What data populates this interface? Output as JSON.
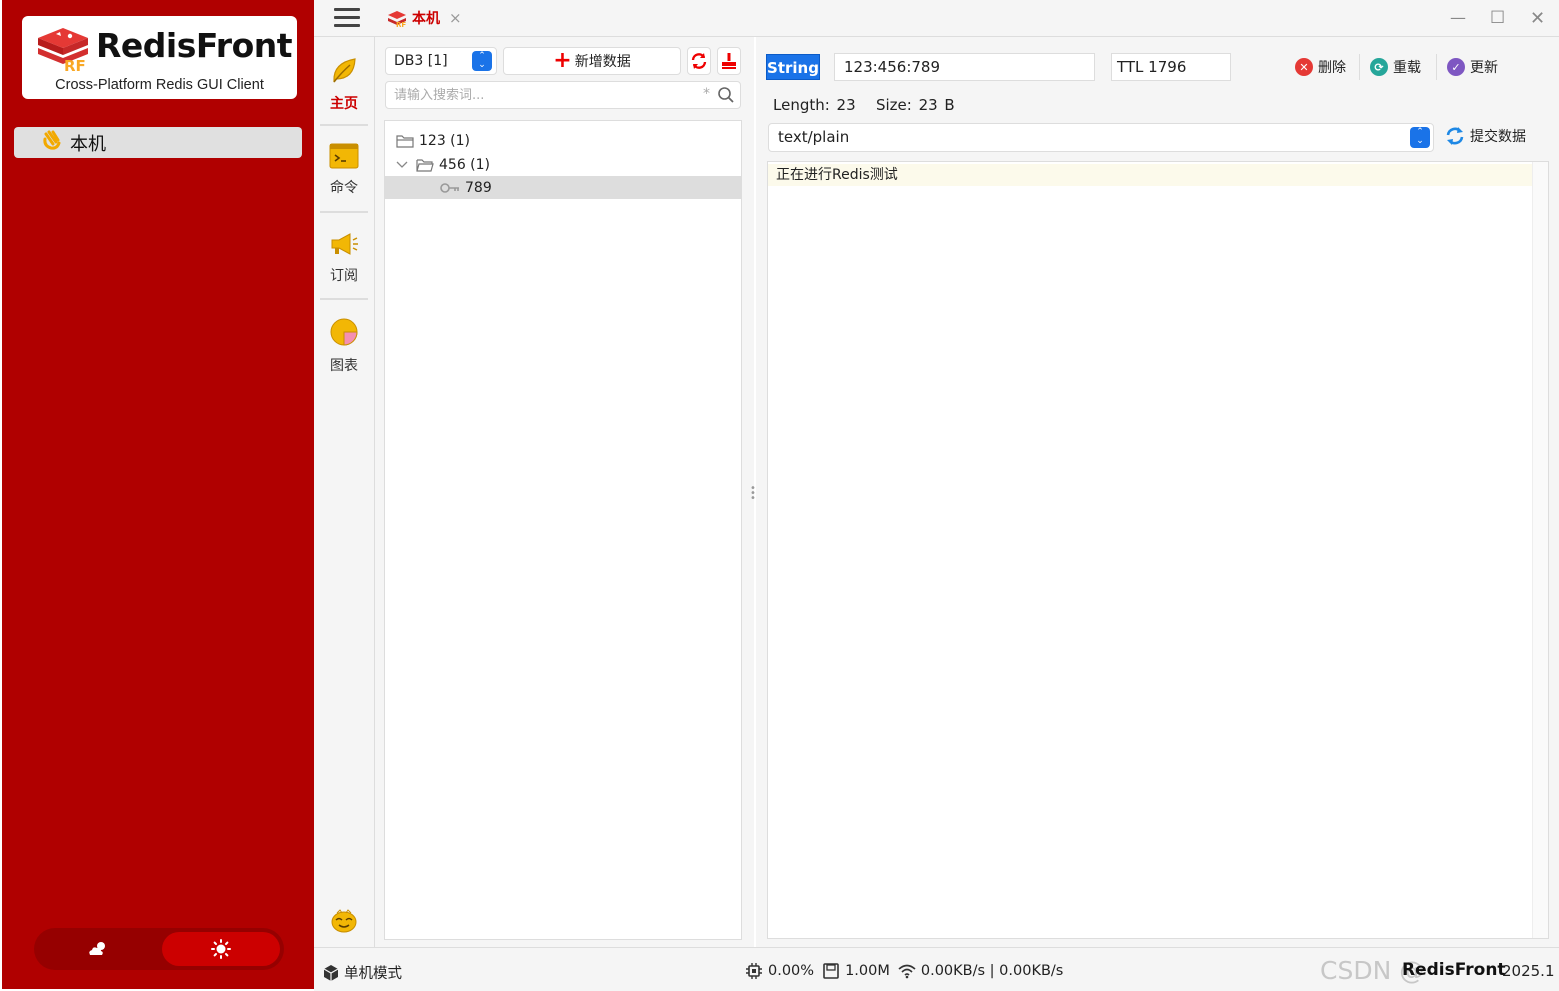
{
  "app": {
    "logo_title": "RedisFront",
    "logo_subtitle": "Cross-Platform Redis GUI Client",
    "connection_label": "本机",
    "colors": {
      "brand_red": "#b00000",
      "accent_blue": "#1a73e8"
    }
  },
  "topbar": {
    "tab_label": "本机",
    "tab_close": "×"
  },
  "nav": {
    "items": [
      {
        "label": "主页",
        "icon": "leaf-icon",
        "active": true
      },
      {
        "label": "命令",
        "icon": "terminal-icon"
      },
      {
        "label": "订阅",
        "icon": "megaphone-icon"
      },
      {
        "label": "图表",
        "icon": "pie-chart-icon"
      }
    ]
  },
  "keys": {
    "db_selected": "DB3 [1]",
    "add_label": "新增数据",
    "search_placeholder": "请输入搜索词...",
    "search_wildcard": "*",
    "tree": [
      {
        "label": "123 (1)",
        "type": "folder"
      },
      {
        "label": "456 (1)",
        "type": "folder",
        "expanded": true
      },
      {
        "label": "789",
        "type": "key",
        "selected": true
      }
    ]
  },
  "value": {
    "type": "String",
    "key": "123:456:789",
    "ttl": "TTL 1796",
    "delete_label": "删除",
    "reload_label": "重载",
    "update_label": "更新",
    "length_text": "Length: 23",
    "size_text": "Size: 23 B",
    "format": "text/plain",
    "submit_label": "提交数据",
    "content": "正在进行Redis测试"
  },
  "status": {
    "mode": "单机模式",
    "cpu": "0.00%",
    "memory": "1.00M",
    "network": "0.00KB/s | 0.00KB/s",
    "brand": "RedisFront",
    "version": "2025.1",
    "watermark": "CSDN @"
  }
}
